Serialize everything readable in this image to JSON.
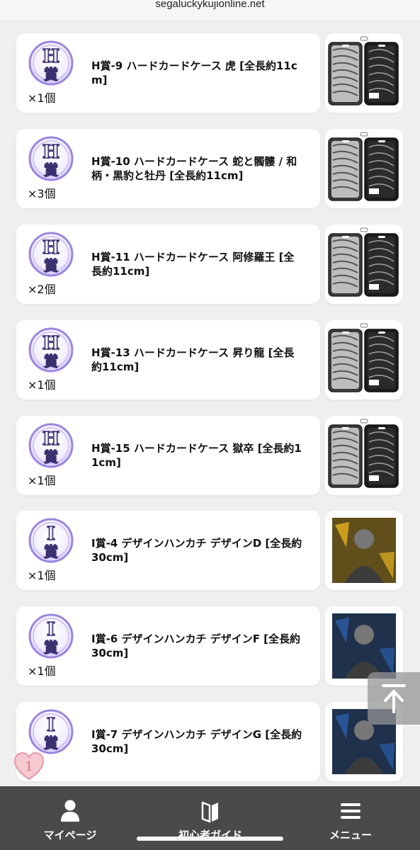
{
  "browser": {
    "url": "segaluckykujionline.net"
  },
  "items": [
    {
      "grade": "H",
      "grade_char": "賞",
      "title": "H賞-9 ハードカードケース 虎 [全長約11cm]",
      "qty": "×1個",
      "thumb": "card-case"
    },
    {
      "grade": "H",
      "grade_char": "賞",
      "title": "H賞-10 ハードカードケース 蛇と髑髏 / 和柄・黒豹と牡丹 [全長約11cm]",
      "qty": "×3個",
      "thumb": "card-case"
    },
    {
      "grade": "H",
      "grade_char": "賞",
      "title": "H賞-11 ハードカードケース 阿修羅王 [全長約11cm]",
      "qty": "×2個",
      "thumb": "card-case"
    },
    {
      "grade": "H",
      "grade_char": "賞",
      "title": "H賞-13 ハードカードケース 昇り龍 [全長約11cm]",
      "qty": "×1個",
      "thumb": "card-case"
    },
    {
      "grade": "H",
      "grade_char": "賞",
      "title": "H賞-15 ハードカードケース 獄卒 [全長約11cm]",
      "qty": "×1個",
      "thumb": "card-case"
    },
    {
      "grade": "I",
      "grade_char": "賞",
      "title": "I賞-4 デザインハンカチ デザインD [全長約30cm]",
      "qty": "×1個",
      "thumb": "handkerchief"
    },
    {
      "grade": "I",
      "grade_char": "賞",
      "title": "I賞-6 デザインハンカチ デザインF [全長約30cm]",
      "qty": "×1個",
      "thumb": "handkerchief"
    },
    {
      "grade": "I",
      "grade_char": "賞",
      "title": "I賞-7 デザインハンカチ デザインG [全長約30cm]",
      "qty": "個",
      "thumb": "handkerchief"
    }
  ],
  "heart_badge": {
    "count": "1"
  },
  "bottom_nav": [
    {
      "label": "マイページ",
      "icon": "person-icon"
    },
    {
      "label": "初心者ガイド",
      "icon": "book-icon"
    },
    {
      "label": "メニュー",
      "icon": "hamburger-menu-icon"
    }
  ],
  "colors": {
    "nav_bg": "#4a4a4a",
    "badge_purple": "#7b5fc9",
    "card_bg": "#ffffff",
    "page_bg": "#efefef"
  }
}
